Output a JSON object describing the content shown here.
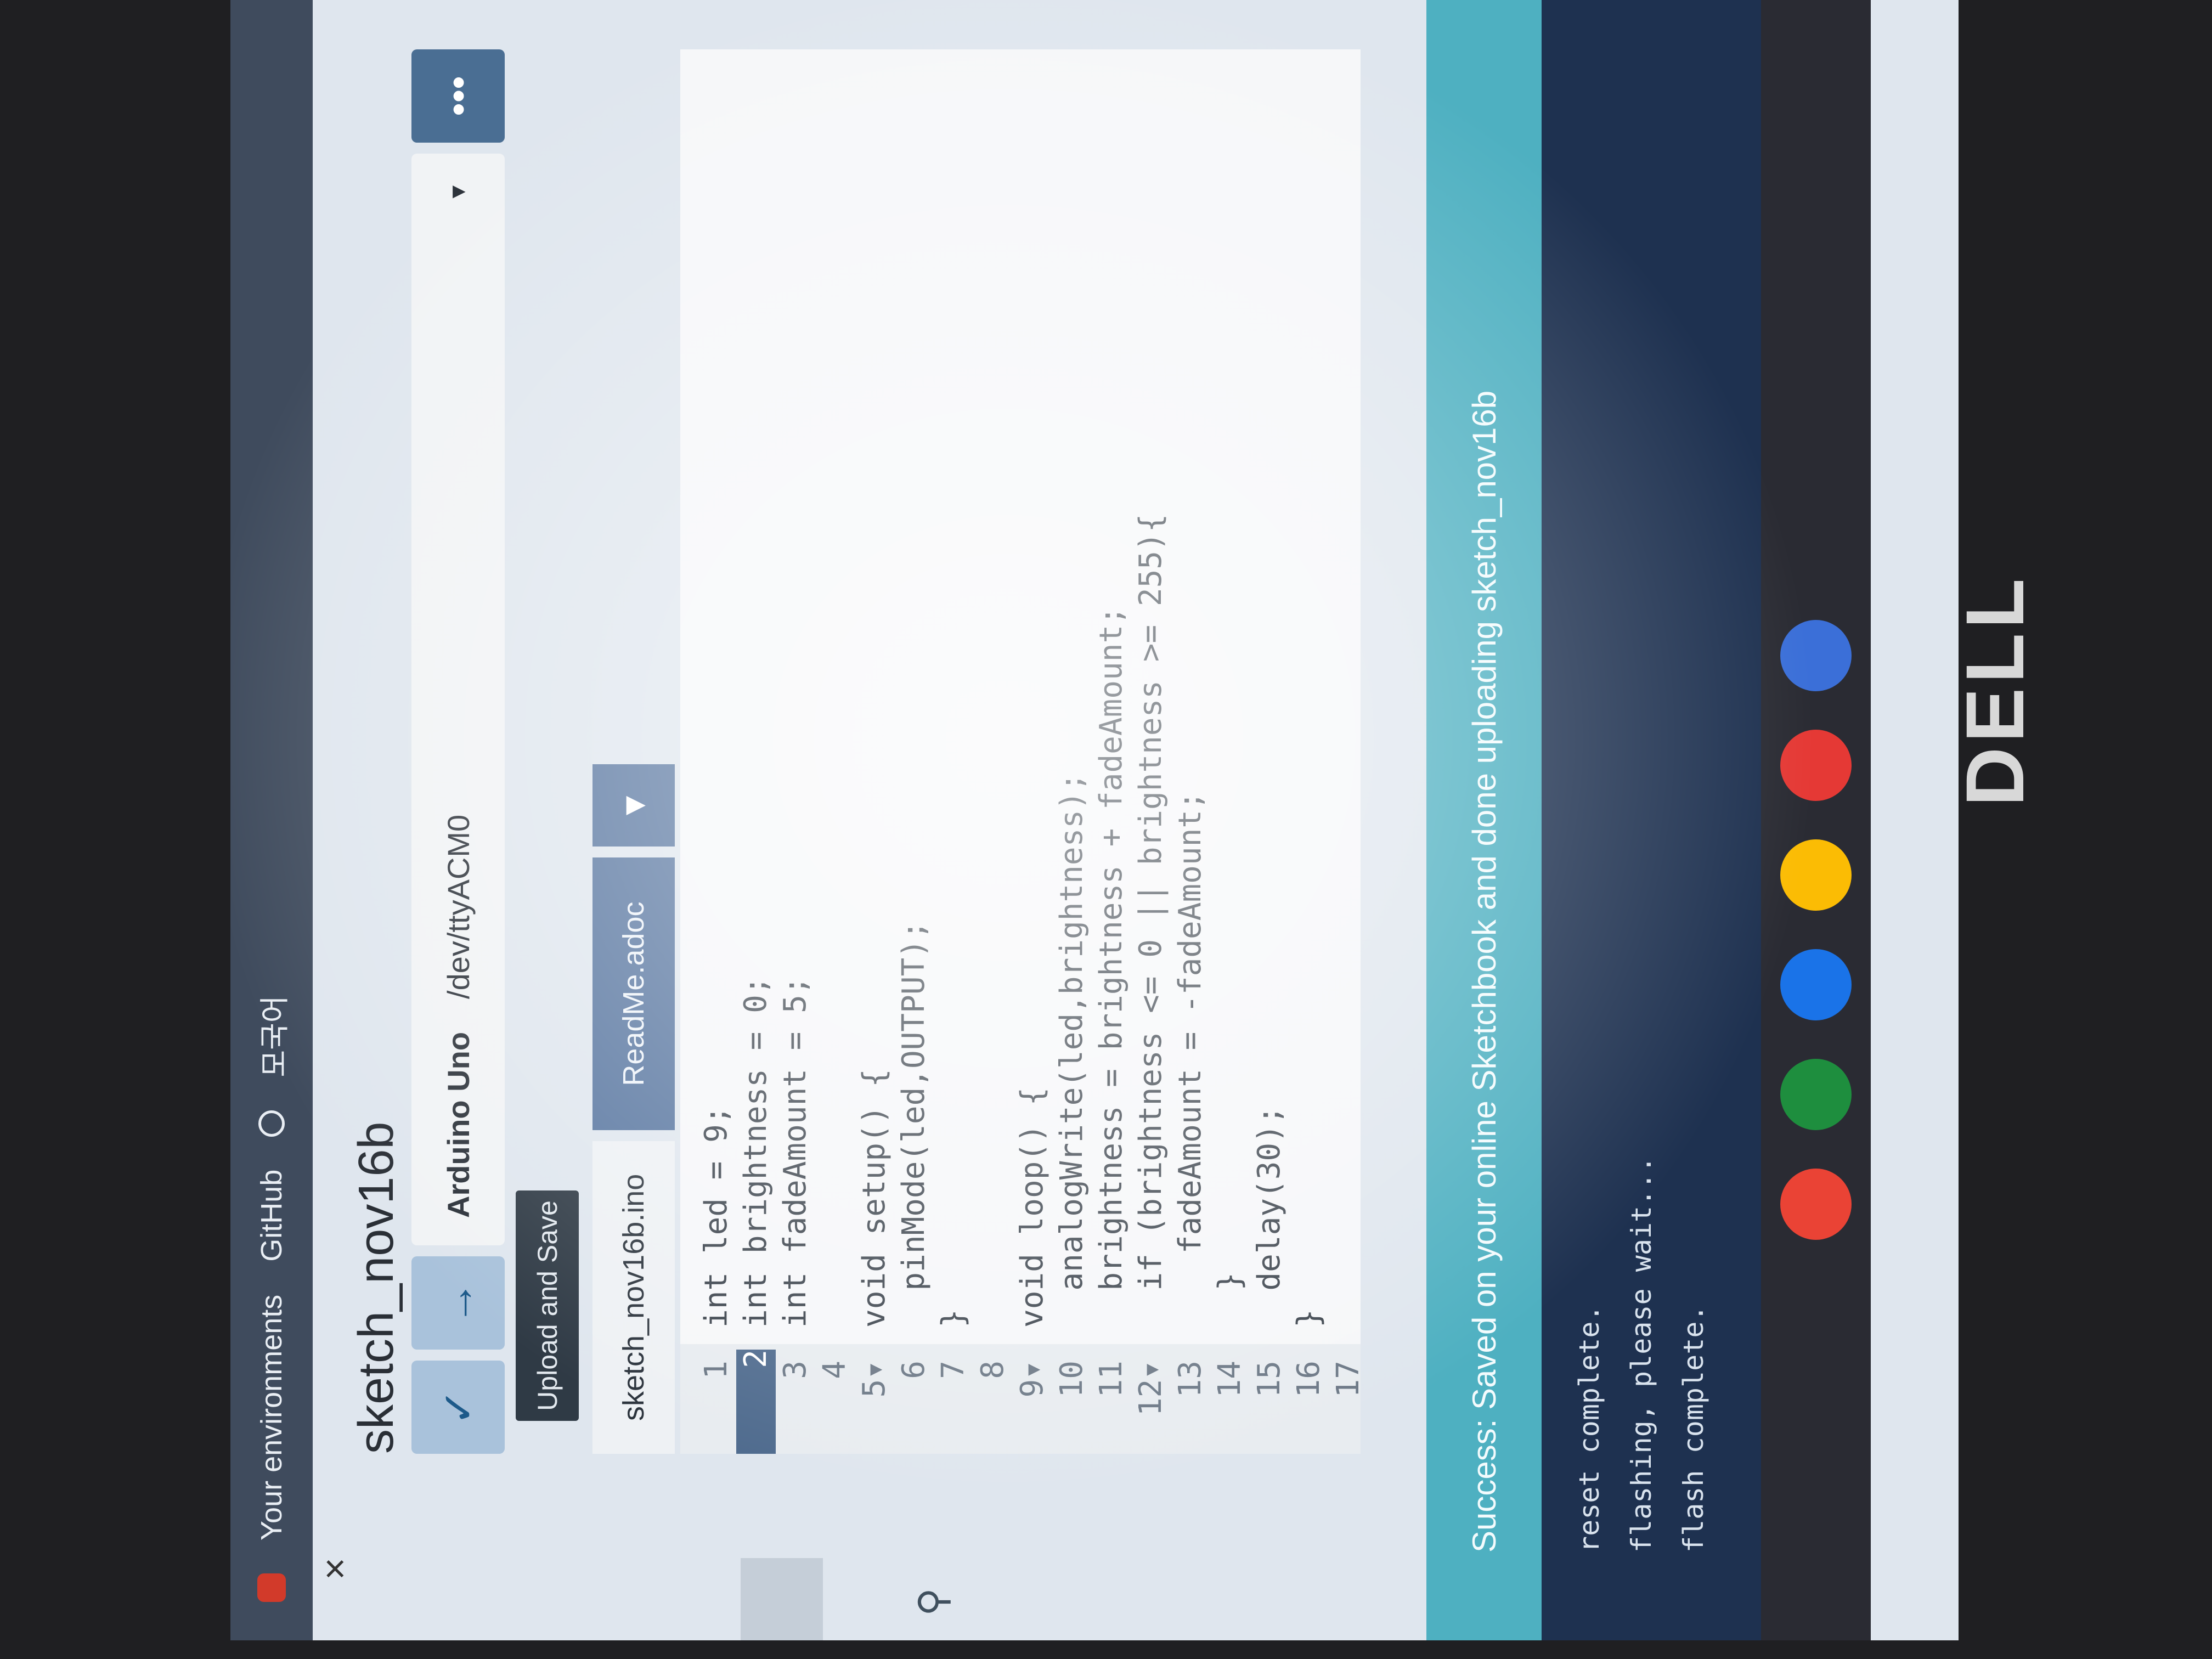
{
  "topnav": {
    "environments": "Your environments",
    "github": "GitHub",
    "language": "모국어"
  },
  "sketch": {
    "title": "sketch_nov16b",
    "close": "×"
  },
  "toolbar": {
    "verify_icon": "check-icon",
    "upload_icon": "upload-arrow-icon",
    "board": "Arduino Uno",
    "port": "/dev/ttyACM0",
    "more": "•••",
    "tooltip": "Upload and Save"
  },
  "tabs": [
    {
      "label": "sketch_nov16b.ino"
    },
    {
      "label": "ReadMe.adoc"
    }
  ],
  "code": {
    "lines": [
      {
        "no": "1",
        "text": "int led = 9;"
      },
      {
        "no": "2",
        "text": "int brightness = 0;"
      },
      {
        "no": "3",
        "text": "int fadeAmount = 5;"
      },
      {
        "no": "4",
        "text": ""
      },
      {
        "no": "5▾",
        "text": "void setup() {"
      },
      {
        "no": "6",
        "text": "  pinMode(led,OUTPUT);"
      },
      {
        "no": "7",
        "text": "}"
      },
      {
        "no": "8",
        "text": ""
      },
      {
        "no": "9▾",
        "text": "void loop() {"
      },
      {
        "no": "10",
        "text": "  analogWrite(led,brightness);"
      },
      {
        "no": "11",
        "text": "  brightness = brightness + fadeAmount;"
      },
      {
        "no": "12▾",
        "text": "  if (brightness <= 0 || brightness >= 255){"
      },
      {
        "no": "13",
        "text": "    fadeAmount = -fadeAmount;"
      },
      {
        "no": "14",
        "text": "  }"
      },
      {
        "no": "15",
        "text": "  delay(30);"
      },
      {
        "no": "16",
        "text": "}"
      },
      {
        "no": "17",
        "text": ""
      }
    ]
  },
  "status": {
    "message": "Success: Saved on your online Sketchbook and done uploading sketch_nov16b"
  },
  "console": [
    "reset complete.",
    "flashing, please wait...",
    "flash complete."
  ],
  "shelf": [
    {
      "icon": "chrome-icon",
      "color": "#ea4335"
    },
    {
      "icon": "classroom-icon",
      "color": "#1e8e3e"
    },
    {
      "icon": "meet-icon",
      "color": "#1a73e8"
    },
    {
      "icon": "drive-icon",
      "color": "#fbbc04"
    },
    {
      "icon": "youtube-icon",
      "color": "#e53935"
    },
    {
      "icon": "app-icon",
      "color": "#3b6fd8"
    }
  ],
  "brand": "DELL"
}
